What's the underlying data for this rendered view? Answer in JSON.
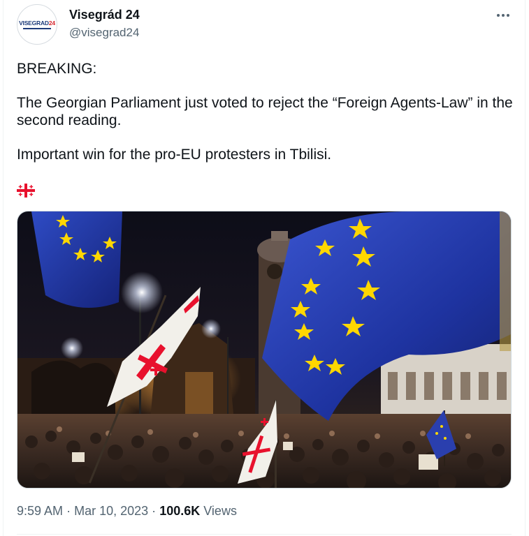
{
  "author": {
    "display_name": "Visegrád 24",
    "handle": "@visegrad24",
    "avatar": {
      "word_main": "VISEGRAD",
      "word_accent": "24"
    }
  },
  "tweet": {
    "paragraphs": [
      "BREAKING:",
      "The Georgian Parliament just voted to reject the “Foreign Agents-Law” in the second reading.",
      "Important win for the pro-EU protesters in Tbilisi."
    ],
    "flag_emoji": "georgia-flag-icon"
  },
  "media": {
    "alt": "Protest crowd at night with EU and Georgian flags"
  },
  "meta": {
    "time": "9:59 AM",
    "separator": "·",
    "date": "Mar 10, 2023",
    "views_count": "100.6K",
    "views_label": "Views"
  },
  "colors": {
    "text_primary": "#0f1419",
    "text_secondary": "#536471",
    "eu_blue": "#1f3aa8",
    "eu_star": "#ffd700",
    "georgia_red": "#e8112d"
  }
}
